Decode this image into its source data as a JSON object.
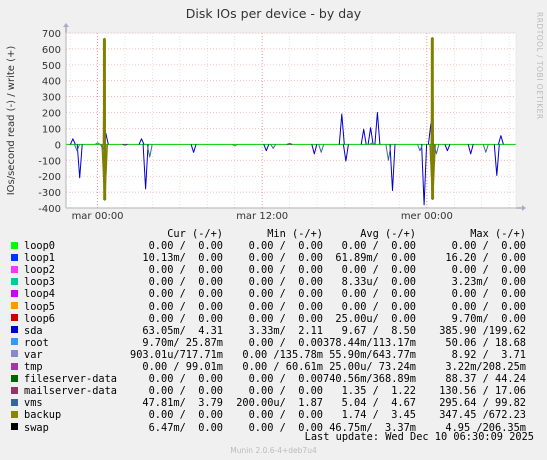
{
  "title": "Disk IOs per device - by day",
  "side_label": "RRDTOOL / TOBI OETIKER",
  "footer": "Munin 2.0.6-4+deb7u4",
  "last_update": "Last update: Wed Dec 10 06:30:09 2025",
  "chart_data": {
    "type": "line",
    "title": "Disk IOs per device - by day",
    "ylabel": "IOs/second read (-) / write (+)",
    "ylim": [
      -400,
      700
    ],
    "yticks": [
      -400,
      -300,
      -200,
      -100,
      0,
      100,
      200,
      300,
      400,
      500,
      600,
      700
    ],
    "xticks": [
      {
        "label": "mar 00:00",
        "hour": 0
      },
      {
        "label": "mar 12:00",
        "hour": 12
      },
      {
        "label": "mer 00:00",
        "hour": 24
      }
    ],
    "x_range_hours": [
      -2.3,
      30.5
    ],
    "grid": true,
    "series": [
      {
        "name": "backup",
        "color": "#808000",
        "spikes": [
          [
            0.5,
            665
          ],
          [
            0.52,
            -350
          ],
          [
            24.4,
            670
          ],
          [
            24.42,
            -345
          ]
        ]
      },
      {
        "name": "sda",
        "color": "#0000cc",
        "spikes": [
          [
            -1.8,
            35
          ],
          [
            -1.3,
            -210
          ],
          [
            0.6,
            70
          ],
          [
            3.2,
            35
          ],
          [
            3.5,
            -280
          ],
          [
            7.0,
            -50
          ],
          [
            12.3,
            -40
          ],
          [
            15.8,
            -60
          ],
          [
            17.8,
            190
          ],
          [
            18.1,
            -105
          ],
          [
            19.4,
            95
          ],
          [
            19.9,
            105
          ],
          [
            20.4,
            200
          ],
          [
            21.5,
            -290
          ],
          [
            23.8,
            -380
          ],
          [
            24.3,
            130
          ],
          [
            25.5,
            -40
          ],
          [
            27.2,
            -60
          ],
          [
            29.1,
            -195
          ],
          [
            29.4,
            55
          ]
        ]
      },
      {
        "name": "vms",
        "color": "#3a6e8f",
        "spikes": [
          [
            -1.5,
            -40
          ],
          [
            0.4,
            -30
          ],
          [
            3.8,
            -80
          ],
          [
            12.8,
            -25
          ],
          [
            16.3,
            -50
          ],
          [
            21.2,
            -100
          ],
          [
            23.5,
            -40
          ],
          [
            24.7,
            -60
          ],
          [
            28.3,
            -50
          ]
        ]
      },
      {
        "name": "mailserver-data",
        "color": "#339933",
        "spikes": [
          [
            0.0,
            10
          ],
          [
            10.0,
            -10
          ],
          [
            20.0,
            8
          ]
        ]
      },
      {
        "name": "fileserver-data",
        "color": "#7a0099",
        "spikes": [
          [
            2.0,
            -5
          ],
          [
            14.0,
            5
          ]
        ]
      }
    ]
  },
  "legend": {
    "headers": {
      "cur": "Cur (-/+)",
      "min": "Min (-/+)",
      "avg": "Avg (-/+)",
      "max": "Max (-/+)"
    },
    "rows": [
      {
        "name": "loop0",
        "color": "#00cc00",
        "cur": "0.00 /  0.00",
        "min": "0.00 /  0.00",
        "avg": "0.00 /  0.00",
        "max": "0.00 /  0.00"
      },
      {
        "name": "loop1",
        "color": "#0066b3",
        "cur": "10.13m/  0.00",
        "min": "0.00 /  0.00",
        "avg": "61.89m/  0.00",
        "max": "16.20 /  0.00"
      },
      {
        "name": "loop2",
        "color": "#ff8000",
        "cur": "0.00 /  0.00",
        "min": "0.00 /  0.00",
        "avg": "0.00 /  0.00",
        "max": "0.00 /  0.00"
      },
      {
        "name": "loop3",
        "color": "#ffcc00",
        "cur": "0.00 /  0.00",
        "min": "0.00 /  0.00",
        "avg": "8.33u/  0.00",
        "max": "3.23m/  0.00"
      },
      {
        "name": "loop4",
        "color": "#330099",
        "cur": "0.00 /  0.00",
        "min": "0.00 /  0.00",
        "avg": "0.00 /  0.00",
        "max": "0.00 /  0.00"
      },
      {
        "name": "loop5",
        "color": "#990099",
        "cur": "0.00 /  0.00",
        "min": "0.00 /  0.00",
        "avg": "0.00 /  0.00",
        "max": "0.00 /  0.00"
      },
      {
        "name": "loop6",
        "color": "#ccff00",
        "cur": "0.00 /  0.00",
        "min": "0.00 /  0.00",
        "avg": "25.00u/  0.00",
        "max": "9.70m/  0.00"
      },
      {
        "name": "sda",
        "color": "#ff0000",
        "cur": "63.05m/  4.31",
        "min": "3.33m/  2.11",
        "avg": "9.67 /  8.50",
        "max": "385.90 /199.62"
      },
      {
        "name": "root",
        "color": "#808080",
        "cur": "9.70m/ 25.87m",
        "min": "0.00 /  0.00",
        "avg": "378.44m/113.17m",
        "max": "50.06 / 18.68"
      },
      {
        "name": "var",
        "color": "#008f00",
        "cur": "903.01u/717.71m",
        "min": "0.00 /135.78m",
        "avg": "55.90m/643.77m",
        "max": "8.92 /  3.71"
      },
      {
        "name": "tmp",
        "color": "#00487d",
        "cur": "0.00 / 99.01m",
        "min": "0.00 / 60.61m",
        "avg": "25.00u/ 73.24m",
        "max": "3.22m/208.25m"
      },
      {
        "name": "fileserver-data",
        "color": "#b35a00",
        "cur": "0.00 /  0.00",
        "min": "0.00 /  0.00",
        "avg": "740.56m/368.89m",
        "max": "88.37 / 44.24"
      },
      {
        "name": "mailserver-data",
        "color": "#b38f00",
        "cur": "0.00 /  0.00",
        "min": "0.00 /  0.00",
        "avg": "1.35 /  1.22",
        "max": "130.56 / 17.06"
      },
      {
        "name": "vms",
        "color": "#6b006b",
        "cur": "47.81m/  3.79",
        "min": "200.00u/  1.87",
        "avg": "5.04 /  4.67",
        "max": "295.64 / 99.82"
      },
      {
        "name": "backup",
        "color": "#8fb300",
        "cur": "0.00 /  0.00",
        "min": "0.00 /  0.00",
        "avg": "1.74 /  3.45",
        "max": "347.45 /672.23"
      },
      {
        "name": "swap",
        "color": "#b30000",
        "cur": "6.47m/  0.00",
        "min": "0.00 /  0.00",
        "avg": "46.75m/  3.37m",
        "max": "4.95 /206.35m"
      }
    ]
  },
  "legend_colors_display": [
    "#00ff00",
    "#0033ff",
    "#ff33ff",
    "#00cc99",
    "#cc00ff",
    "#ff9900",
    "#cc0000",
    "#0000cc",
    "#3399ff",
    "#8888cc",
    "#aa33aa",
    "#006600",
    "#993366",
    "#336699",
    "#888800",
    "#000000"
  ]
}
